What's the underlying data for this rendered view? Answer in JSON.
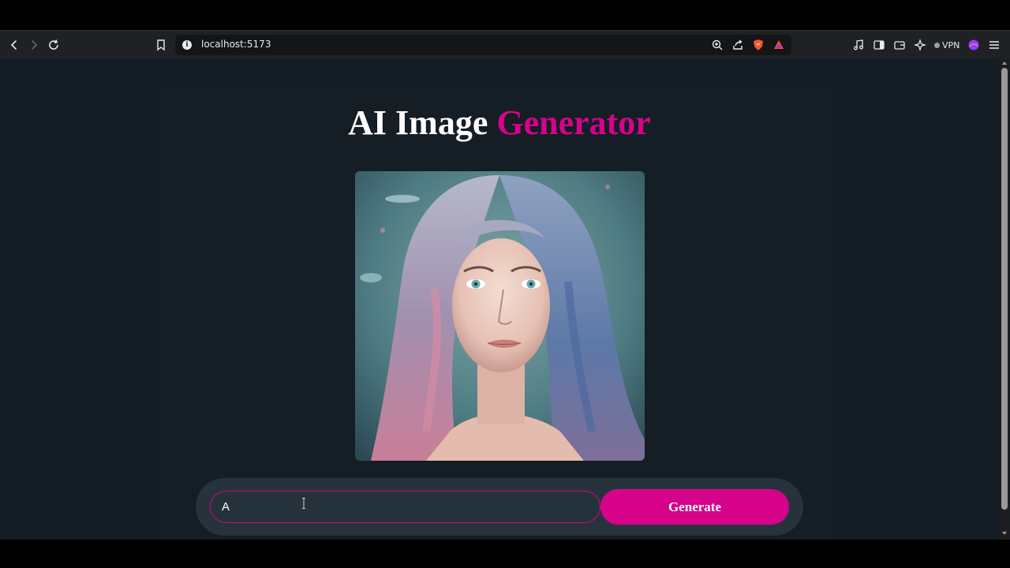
{
  "browser": {
    "url": "localhost:5173",
    "vpn_label": "VPN"
  },
  "app": {
    "title_main": "AI Image",
    "title_accent": "Generator",
    "image_alt": "Generated portrait"
  },
  "prompt": {
    "value": "A",
    "button_label": "Generate"
  },
  "colors": {
    "accent": "#d6038a",
    "background": "#141c24",
    "prompt_bar": "#27333c"
  },
  "icons": [
    "back-icon",
    "forward-icon",
    "reload-icon",
    "bookmark-icon",
    "info-icon",
    "zoom-icon",
    "share-icon",
    "brave-shield-icon",
    "brave-rewards-icon",
    "music-icon",
    "sidebar-icon",
    "wallet-icon",
    "leo-icon",
    "vpn-icon",
    "profile-icon",
    "menu-icon"
  ]
}
